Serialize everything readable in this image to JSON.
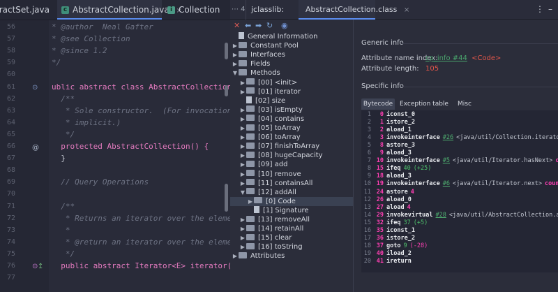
{
  "editor": {
    "tabs": [
      {
        "label": "tractSet.java",
        "active": false
      },
      {
        "label": "AbstractCollection.java",
        "active": true
      },
      {
        "label": "Collection",
        "active": false
      }
    ],
    "lines": [
      {
        "num": "56",
        "text": "* @author  Neal Gafter"
      },
      {
        "num": "57",
        "text": "* @see Collection"
      },
      {
        "num": "58",
        "text": "* @since 1.2"
      },
      {
        "num": "59",
        "text": "*/"
      },
      {
        "num": "60",
        "text": ""
      },
      {
        "num": "61",
        "text": "ublic abstract class AbstractCollection<E> i"
      },
      {
        "num": "62",
        "text": "  /**"
      },
      {
        "num": "63",
        "text": "   * Sole constructor.  (For invocation by"
      },
      {
        "num": "64",
        "text": "   * implicit.)"
      },
      {
        "num": "65",
        "text": "   */"
      },
      {
        "num": "66",
        "text": "  protected AbstractCollection() {"
      },
      {
        "num": "67",
        "text": "  }"
      },
      {
        "num": "68",
        "text": ""
      },
      {
        "num": "69",
        "text": "  // Query Operations"
      },
      {
        "num": "70",
        "text": ""
      },
      {
        "num": "71",
        "text": "  /**"
      },
      {
        "num": "72",
        "text": "   * Returns an iterator over the elements"
      },
      {
        "num": "73",
        "text": "   *"
      },
      {
        "num": "74",
        "text": "   * @return an iterator over the elements"
      },
      {
        "num": "75",
        "text": "   */"
      },
      {
        "num": "76",
        "text": "  public abstract Iterator<E> iterator();"
      },
      {
        "num": "77",
        "text": ""
      }
    ]
  },
  "jclasslib": {
    "tab_prefix": "jclasslib:",
    "tab_label": "AbstractCollection.class",
    "toolbar": [
      "close-icon",
      "back-icon",
      "forward-icon",
      "refresh-icon",
      "web-icon"
    ],
    "tree": [
      {
        "label": "General Information",
        "indent": 0,
        "kind": "doc",
        "arrow": ""
      },
      {
        "label": "Constant Pool",
        "indent": 0,
        "kind": "folder",
        "arrow": "▶"
      },
      {
        "label": "Interfaces",
        "indent": 0,
        "kind": "folder",
        "arrow": "▶"
      },
      {
        "label": "Fields",
        "indent": 0,
        "kind": "folder",
        "arrow": "▶"
      },
      {
        "label": "Methods",
        "indent": 0,
        "kind": "folder",
        "arrow": "▼"
      },
      {
        "label": "[00] <init>",
        "indent": 1,
        "kind": "folder",
        "arrow": "▶"
      },
      {
        "label": "[01] iterator",
        "indent": 1,
        "kind": "folder",
        "arrow": "▶"
      },
      {
        "label": "[02] size",
        "indent": 1,
        "kind": "doc",
        "arrow": ""
      },
      {
        "label": "[03] isEmpty",
        "indent": 1,
        "kind": "folder",
        "arrow": "▶"
      },
      {
        "label": "[04] contains",
        "indent": 1,
        "kind": "folder",
        "arrow": "▶"
      },
      {
        "label": "[05] toArray",
        "indent": 1,
        "kind": "folder",
        "arrow": "▶"
      },
      {
        "label": "[06] toArray",
        "indent": 1,
        "kind": "folder",
        "arrow": "▶"
      },
      {
        "label": "[07] finishToArray",
        "indent": 1,
        "kind": "folder",
        "arrow": "▶"
      },
      {
        "label": "[08] hugeCapacity",
        "indent": 1,
        "kind": "folder",
        "arrow": "▶"
      },
      {
        "label": "[09] add",
        "indent": 1,
        "kind": "folder",
        "arrow": "▶"
      },
      {
        "label": "[10] remove",
        "indent": 1,
        "kind": "folder",
        "arrow": "▶"
      },
      {
        "label": "[11] containsAll",
        "indent": 1,
        "kind": "folder",
        "arrow": "▶"
      },
      {
        "label": "[12] addAll",
        "indent": 1,
        "kind": "folder",
        "arrow": "▼"
      },
      {
        "label": "[0] Code",
        "indent": 2,
        "kind": "folder",
        "arrow": "▶",
        "selected": true
      },
      {
        "label": "[1] Signature",
        "indent": 2,
        "kind": "doc",
        "arrow": ""
      },
      {
        "label": "[13] removeAll",
        "indent": 1,
        "kind": "folder",
        "arrow": "▶"
      },
      {
        "label": "[14] retainAll",
        "indent": 1,
        "kind": "folder",
        "arrow": "▶"
      },
      {
        "label": "[15] clear",
        "indent": 1,
        "kind": "folder",
        "arrow": "▶"
      },
      {
        "label": "[16] toString",
        "indent": 1,
        "kind": "folder",
        "arrow": "▶"
      },
      {
        "label": "Attributes",
        "indent": 0,
        "kind": "folder",
        "arrow": "▶"
      }
    ],
    "generic_info": {
      "heading": "Generic info",
      "name_index_label": "Attribute name index:",
      "name_index_link": "cp_info #44",
      "name_index_value": "<Code>",
      "length_label": "Attribute length:",
      "length_value": "105"
    },
    "specific_info": {
      "heading": "Specific info",
      "tabs": [
        "Bytecode",
        "Exception table",
        "Misc"
      ],
      "active_tab": "Bytecode"
    },
    "bytecode": [
      {
        "line": "1",
        "offset": "0",
        "op": "iconst_0",
        "ref": "",
        "args": "",
        "extra": ""
      },
      {
        "line": "2",
        "offset": "1",
        "op": "istore_2",
        "ref": "",
        "args": "",
        "extra": ""
      },
      {
        "line": "3",
        "offset": "2",
        "op": "aload_1",
        "ref": "",
        "args": "",
        "extra": ""
      },
      {
        "line": "4",
        "offset": "3",
        "op": "invokeinterface",
        "ref": "#26",
        "args": "<java/util/Collection.iterator>",
        "extra": "co"
      },
      {
        "line": "5",
        "offset": "8",
        "op": "astore_3",
        "ref": "",
        "args": "",
        "extra": ""
      },
      {
        "line": "6",
        "offset": "9",
        "op": "aload_3",
        "ref": "",
        "args": "",
        "extra": ""
      },
      {
        "line": "7",
        "offset": "10",
        "op": "invokeinterface",
        "ref": "#5",
        "args": "<java/util/Iterator.hasNext>",
        "extra": "count"
      },
      {
        "line": "8",
        "offset": "15",
        "op": "ifeq",
        "ref": "40",
        "args": "",
        "extra": "(+25)"
      },
      {
        "line": "9",
        "offset": "18",
        "op": "aload_3",
        "ref": "",
        "args": "",
        "extra": ""
      },
      {
        "line": "10",
        "offset": "19",
        "op": "invokeinterface",
        "ref": "#6",
        "args": "<java/util/Iterator.next>",
        "extra": "count 1"
      },
      {
        "line": "11",
        "offset": "24",
        "op": "astore",
        "ref": "",
        "args": "",
        "extra": "4"
      },
      {
        "line": "12",
        "offset": "26",
        "op": "aload_0",
        "ref": "",
        "args": "",
        "extra": ""
      },
      {
        "line": "13",
        "offset": "27",
        "op": "aload",
        "ref": "",
        "args": "",
        "extra": "4"
      },
      {
        "line": "14",
        "offset": "29",
        "op": "invokevirtual",
        "ref": "#28",
        "args": "<java/util/AbstractCollection.add>",
        "extra": ""
      },
      {
        "line": "15",
        "offset": "32",
        "op": "ifeq",
        "ref": "37",
        "args": "",
        "extra": "(+5)"
      },
      {
        "line": "16",
        "offset": "35",
        "op": "iconst_1",
        "ref": "",
        "args": "",
        "extra": ""
      },
      {
        "line": "17",
        "offset": "36",
        "op": "istore_2",
        "ref": "",
        "args": "",
        "extra": ""
      },
      {
        "line": "18",
        "offset": "37",
        "op": "goto",
        "ref": "9",
        "args": "",
        "extra": "(-28)"
      },
      {
        "line": "19",
        "offset": "40",
        "op": "iload_2",
        "ref": "",
        "args": "",
        "extra": ""
      },
      {
        "line": "20",
        "offset": "41",
        "op": "ireturn",
        "ref": "",
        "args": "",
        "extra": ""
      }
    ],
    "header_icons": [
      "more-icon",
      "minimize-icon"
    ]
  },
  "colors": {
    "accent": "#5b8def",
    "link": "#49a36c",
    "value_red": "#e4564a",
    "offset_pink": "#ff3fb3",
    "keyword": "#e57bc0",
    "type": "#f3c86b"
  }
}
